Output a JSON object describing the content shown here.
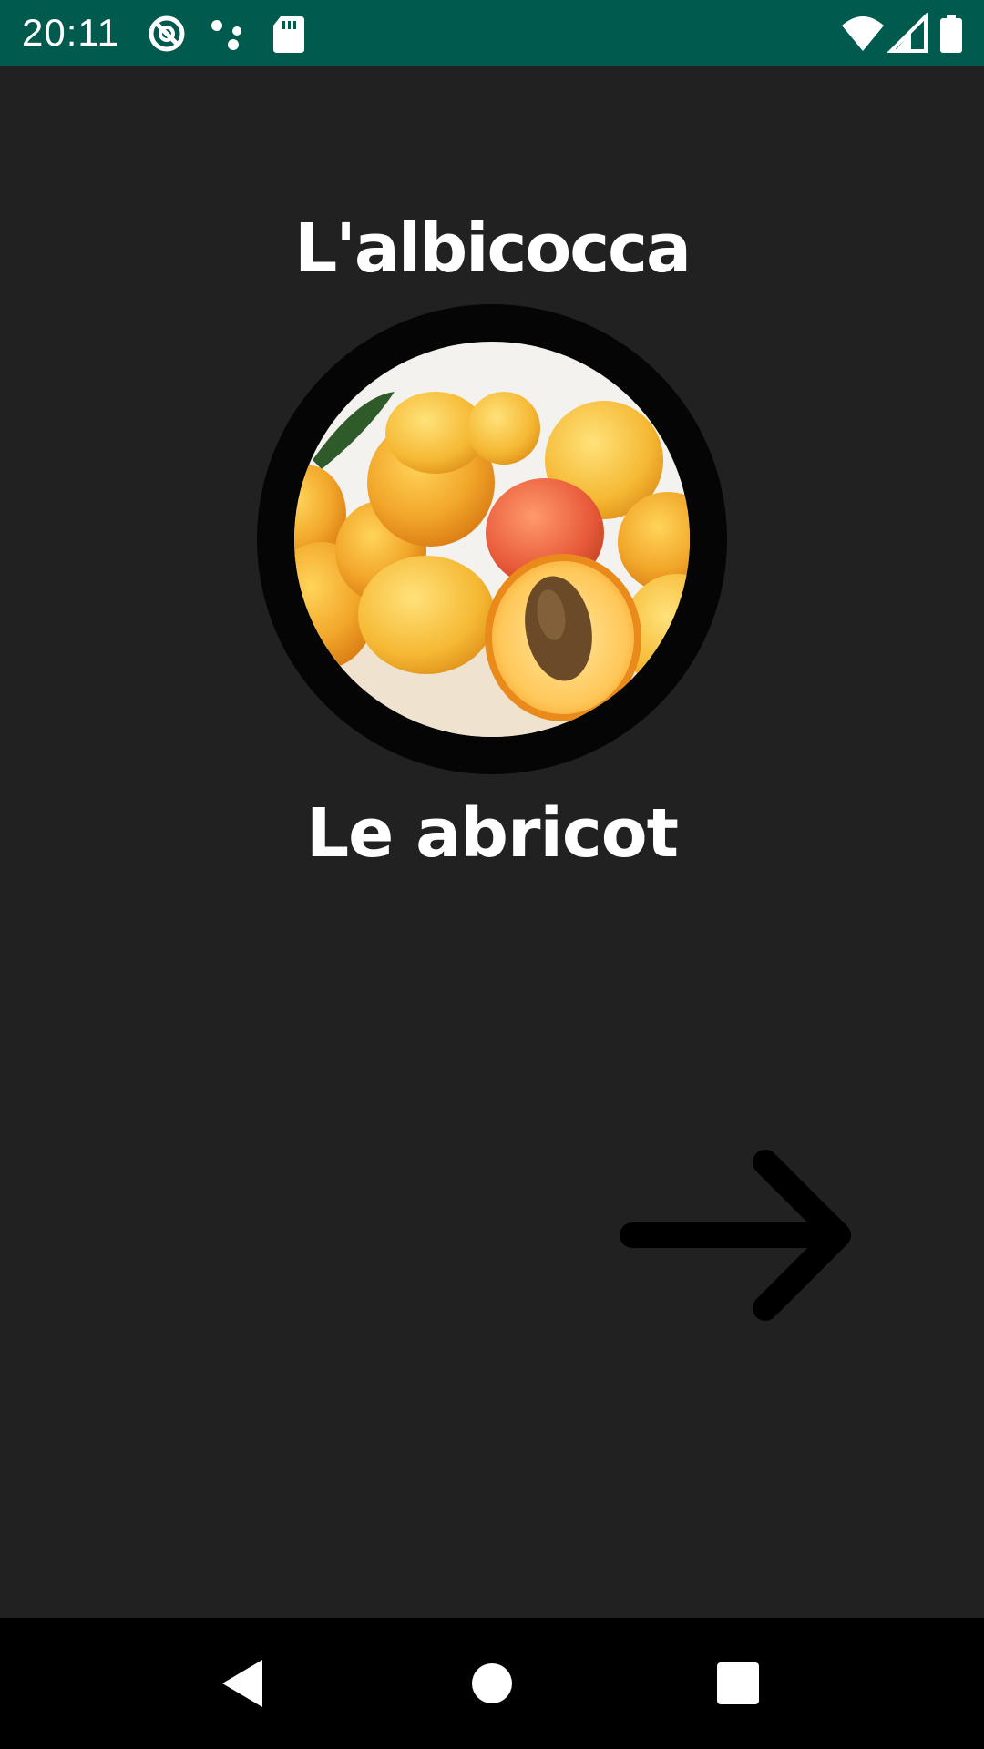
{
  "status_bar": {
    "time": "20:11",
    "icons_left": [
      "do-not-disturb-icon",
      "assistant-dots-icon",
      "sd-card-icon"
    ],
    "icons_right": [
      "wifi-icon",
      "cell-signal-icon",
      "battery-icon"
    ],
    "background_color": "#005a4e"
  },
  "main": {
    "title": "L'albicocca",
    "subtitle": "Le abricot",
    "image_icon": "apricot-photo",
    "next_icon": "arrow-right-icon",
    "background_color": "#212121"
  },
  "nav_bar": {
    "buttons": [
      "back-icon",
      "home-icon",
      "recents-icon"
    ]
  }
}
